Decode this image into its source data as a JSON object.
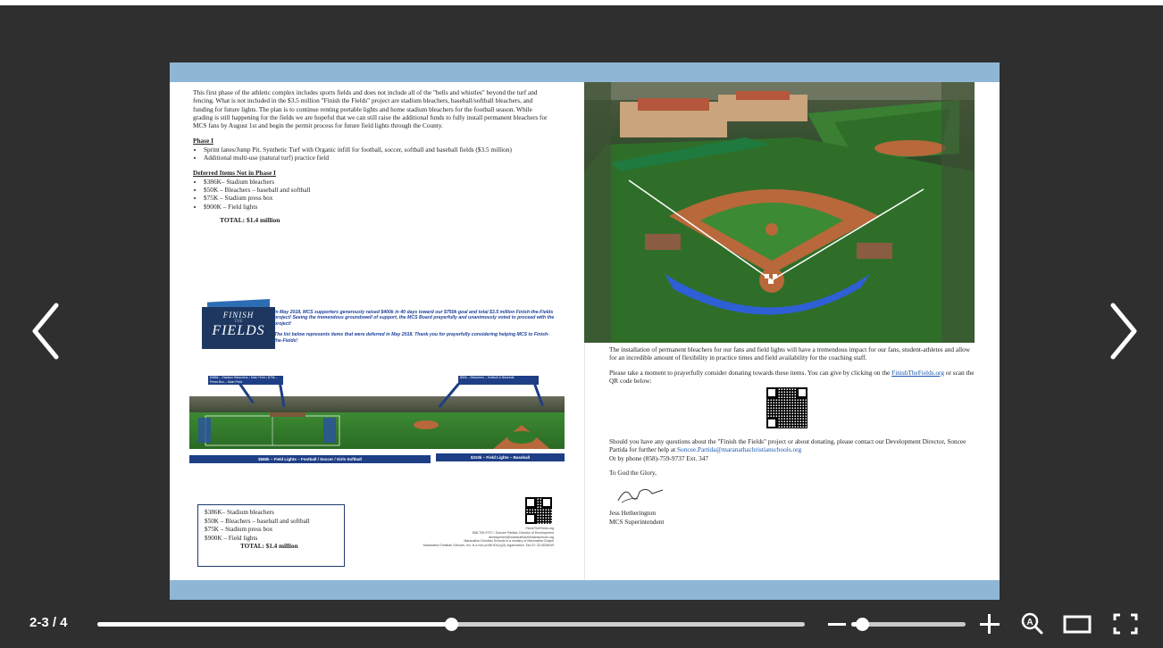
{
  "viewer": {
    "page_indicator": "2-3 / 4",
    "progress_fraction": 0.5,
    "zoom_fraction": 0.09,
    "prev_icon": "chevron-left-icon",
    "next_icon": "chevron-right-icon",
    "zoom_out_icon": "minus-icon",
    "zoom_in_icon": "plus-icon",
    "auto_zoom_icon": "magnifier-a-icon",
    "single_page_icon": "rectangle-icon",
    "fullscreen_icon": "fullscreen-icon"
  },
  "left_page": {
    "intro": "This first phase of the athletic complex includes sports fields and does not include all of the \"bells and whistles\" beyond the turf and fencing. What is not included in the $3.5 million \"Finish the Fields\" project are stadium bleachers, baseball/softball bleachers, and funding for future lights. The plan is to continue renting portable lights and home stadium bleachers for the football season. While grading is still happening for the fields we are hopeful that we can still raise the additional funds to fully install permanent bleachers for MCS fans by August 1st and begin the permit process for future field lights through the County.",
    "phase_heading": "Phase I",
    "phase_items": [
      "Sprint lanes/Jump Pit. Synthetic Turf with Organic infill for football, soccer, softball and baseball fields ($3.5 million)",
      "Additional multi-use (natural turf) practice field"
    ],
    "deferred_heading": "Deferred Items Not in Phase I",
    "deferred_items": [
      "$386K– Stadium bleachers",
      "$50K – Bleachers – baseball and softball",
      "$75K – Stadium press box",
      "$900K – Field lights"
    ],
    "total": "TOTAL: $1.4 million",
    "logo_line1": "FINISH",
    "logo_line2": "THE",
    "logo_line3": "FIELDS",
    "blue_note_1": "In May 2018, MCS supporters generously raised $400k in 40 days toward our $750k goal and total $3.5 million Finish-the-Fields project! Seeing the tremendous groundswell of support, the MCS Board prayerfully and unanimously voted to proceed with the project!",
    "blue_note_2": "The list below represents items that were deferred in May 2018. Thank you for prayerfully considering helping MCS to Finish-the-Fields!",
    "field_box_1": "$386k – Stadium Bleachers / Main Field • $75k – Press Box – Main Field",
    "field_box_2": "$50k – Bleachers – Softball & Baseball",
    "field_bar_1": "$585k – Field Lights – Football / Soccer / Girls Softball",
    "field_bar_2": "$310k – Field Lights – Baseball",
    "cost_lines": [
      "$386K– Stadium bleachers",
      "$50K – Bleachers – baseball and softball",
      "$75K – Stadium press box",
      "$900K – Field lights"
    ],
    "cost_total": "TOTAL: $1.4 million",
    "footer_small_1": "FinishTheFields.org",
    "footer_small_2": "858-759-9737 • Soncee Partida, Director of Development",
    "footer_small_3": "development@maranathachristianschools.org",
    "footer_small_4": "Maranatha Christian Schools is a ministry of Maranatha Chapel",
    "footer_small_5": "Maranatha Christian Schools, Inc. is a non-profit 501(c)(3) organization. Tax ID: 33-0636049"
  },
  "right_page": {
    "para1": "The installation of permanent bleachers for our fans and field lights will have a tremendous impact for our fans, student-athletes and allow for an incredible amount of flexibility in practice times and field availability for the coaching staff.",
    "para2_a": "Please take a moment to prayerfully consider donating towards these items. You can give by clicking on the",
    "para2_link": "FinishTheFields.org",
    "para2_b": "or scan the QR code below:",
    "para3_a": "Should you have any questions about the \"Finish the Fields\" project or about donating, please contact our Development Director, Soncee Partida for further help at",
    "para3_email": "Soncee.Partida@maranathachristianschools.org",
    "para3_b": "Or by phone (858)-759-9737 Ext. 347",
    "closing": "To God the Glory,",
    "signer_name": "Jess Hetherington",
    "signer_title": "MCS Superintendent"
  }
}
